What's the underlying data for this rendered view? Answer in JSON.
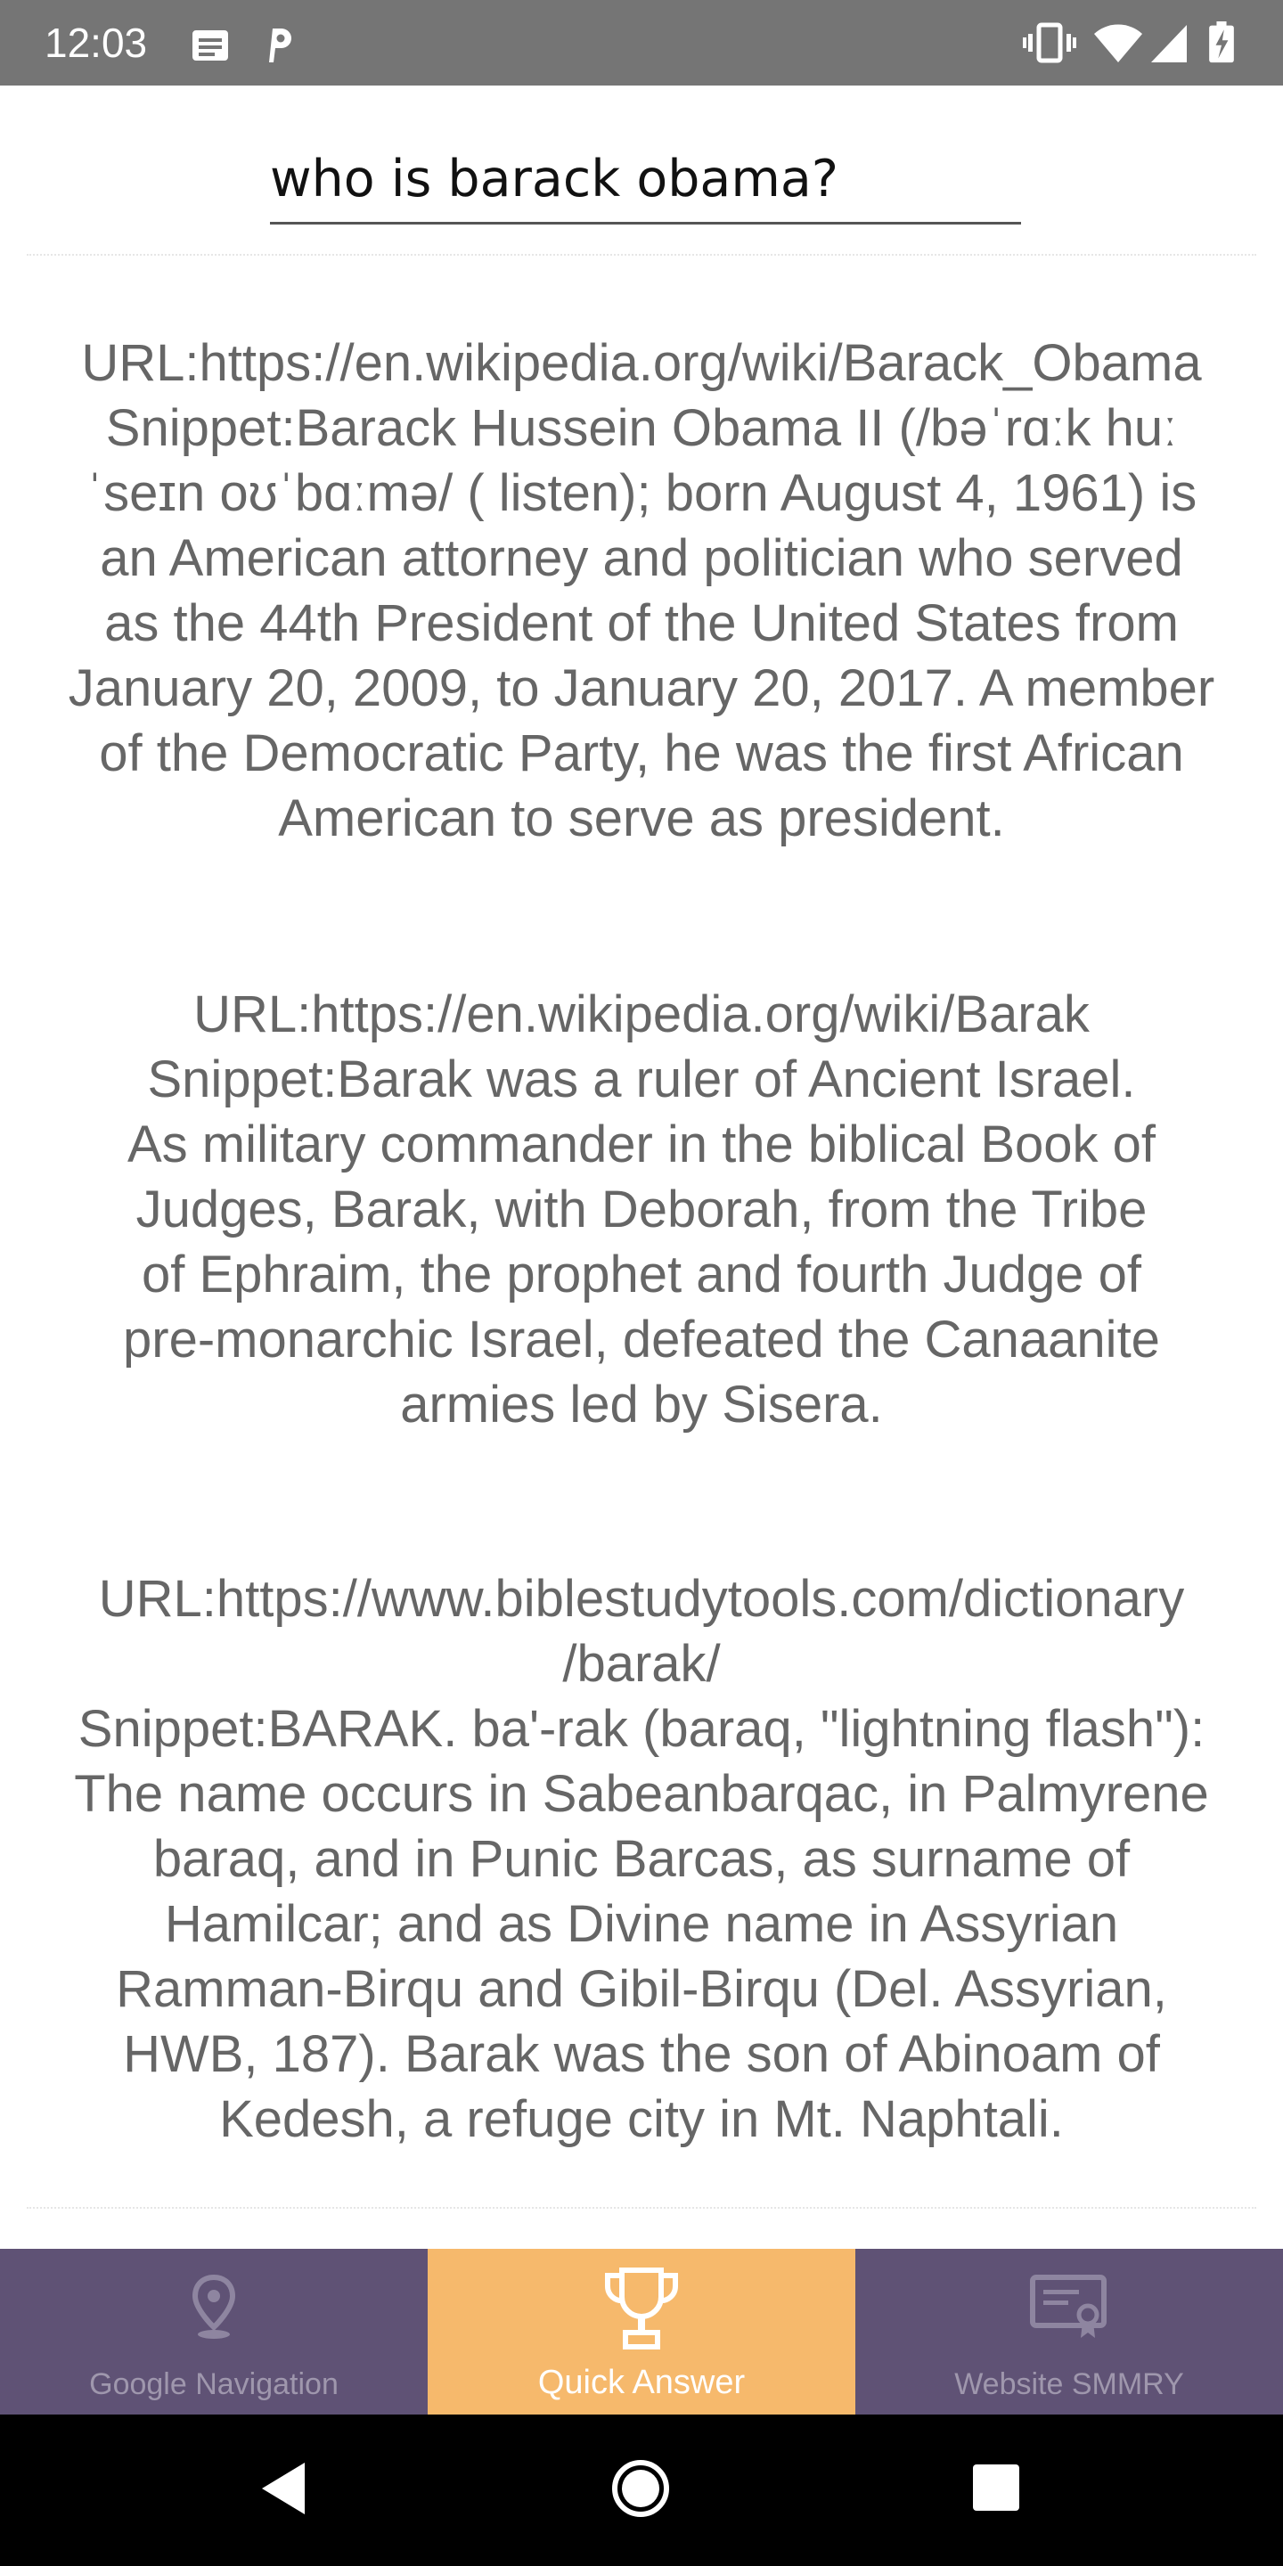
{
  "status_bar": {
    "time": "12:03",
    "left_icons": [
      "message-icon",
      "parking-icon"
    ],
    "right_icons": [
      "vibrate-icon",
      "wifi-icon",
      "signal-icon",
      "battery-icon"
    ]
  },
  "search": {
    "query": "who is barack obama?"
  },
  "results": [
    {
      "text": "URL:https://en.wikipedia.org/wiki/Barack_Obama\nSnippet:Barack Hussein Obama II (/bəˈrɑːk huː\nˈseɪn oʊˈbɑːmə/ ( listen); born August 4, 1961) is\nan American attorney and politician who served\nas the 44th President of the United States from\nJanuary 20, 2009, to January 20, 2017. A member\nof the Democratic Party, he was the first African\nAmerican to serve as president."
    },
    {
      "text": "URL:https://en.wikipedia.org/wiki/Barak\nSnippet:Barak was a ruler of Ancient Israel.\nAs military commander in the biblical Book of\nJudges, Barak, with Deborah, from the Tribe\nof Ephraim, the prophet and fourth Judge of\npre-monarchic Israel, defeated the Canaanite\narmies led by Sisera."
    },
    {
      "text": "URL:https://www.biblestudytools.com/dictionary\n/barak/\nSnippet:BARAK. ba'-rak (baraq, \"lightning flash\"):\nThe name occurs in Sabeanbarqac, in Palmyrene\nbaraq, and in Punic Barcas, as surname of\nHamilcar; and as Divine name in Assyrian\nRamman-Birqu and Gibil-Birqu (Del. Assyrian,\nHWB, 187). Barak was the son of Abinoam of\nKedesh, a refuge city in Mt. Naphtali."
    }
  ],
  "bottom_nav": {
    "tabs": [
      {
        "label": "Google Navigation",
        "icon": "map-pin-icon",
        "active": false
      },
      {
        "label": "Quick Answer",
        "icon": "trophy-icon",
        "active": true
      },
      {
        "label": "Website SMMRY",
        "icon": "certificate-icon",
        "active": false
      }
    ]
  },
  "colors": {
    "status_bar": "#757575",
    "nav_background": "#5f5275",
    "nav_active": "#f6b96c",
    "result_text": "#666666"
  },
  "system_nav": {
    "buttons": [
      "back-icon",
      "home-icon",
      "recents-icon"
    ]
  }
}
